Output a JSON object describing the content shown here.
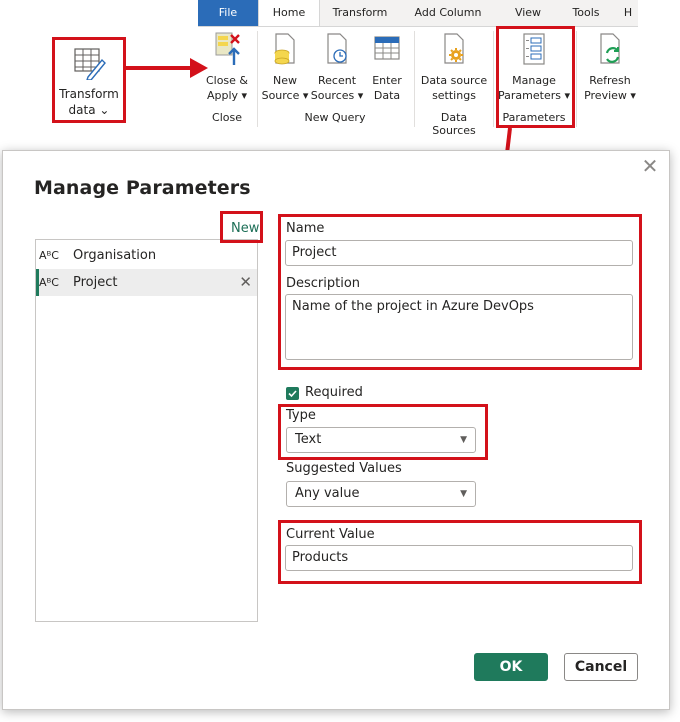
{
  "ribbon": {
    "tabs": [
      "File",
      "Home",
      "Transform",
      "Add Column",
      "View",
      "Tools",
      "H"
    ],
    "active_tab": "Home",
    "buttons": {
      "close_apply": [
        "Close &",
        "Apply ▾"
      ],
      "new_source": [
        "New",
        "Source ▾"
      ],
      "recent_sources": [
        "Recent",
        "Sources ▾"
      ],
      "enter_data": [
        "Enter",
        "Data"
      ],
      "data_source_settings": [
        "Data source",
        "settings"
      ],
      "manage_parameters": [
        "Manage",
        "Parameters ▾"
      ],
      "refresh_preview": [
        "Refresh",
        "Preview ▾"
      ]
    },
    "groups": {
      "close": "Close",
      "new_query": "New Query",
      "data_sources": "Data Sources",
      "parameters": "Parameters"
    }
  },
  "transform_data": {
    "line1": "Transform",
    "line2": "data ⌄"
  },
  "dialog": {
    "title": "Manage Parameters",
    "new_label": "New",
    "parameters": [
      {
        "prefix": "AᴮC",
        "name": "Organisation",
        "selected": false
      },
      {
        "prefix": "AᴮC",
        "name": "Project",
        "selected": true
      }
    ],
    "fields": {
      "name_label": "Name",
      "name_value": "Project",
      "description_label": "Description",
      "description_value": "Name of the project in Azure DevOps",
      "required_label": "Required",
      "required_checked": true,
      "type_label": "Type",
      "type_value": "Text",
      "suggested_label": "Suggested Values",
      "suggested_value": "Any value",
      "current_label": "Current Value",
      "current_value": "Products"
    },
    "ok_label": "OK",
    "cancel_label": "Cancel"
  },
  "colors": {
    "accent": "#1f7a5c",
    "file_tab": "#2b6cb8",
    "highlight": "#d3111a"
  }
}
